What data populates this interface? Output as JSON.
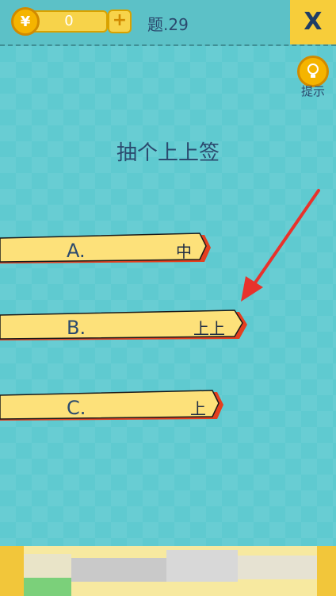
{
  "header": {
    "coin_symbol": "¥",
    "coins": "0",
    "plus_symbol": "+",
    "level": "题.29",
    "close_symbol": "X"
  },
  "hint": {
    "label": "提示"
  },
  "question": "抽个上上签",
  "options": [
    {
      "letter": "A.",
      "answer": "中"
    },
    {
      "letter": "B.",
      "answer": "上上"
    },
    {
      "letter": "C.",
      "answer": "上"
    }
  ],
  "colors": {
    "background": "#5ec9cf",
    "stick": "#fde17a",
    "stick_shadow": "#e43f1f",
    "coin": "#f5b400",
    "arrow": "#e8322c",
    "text": "#2b4a6e"
  }
}
